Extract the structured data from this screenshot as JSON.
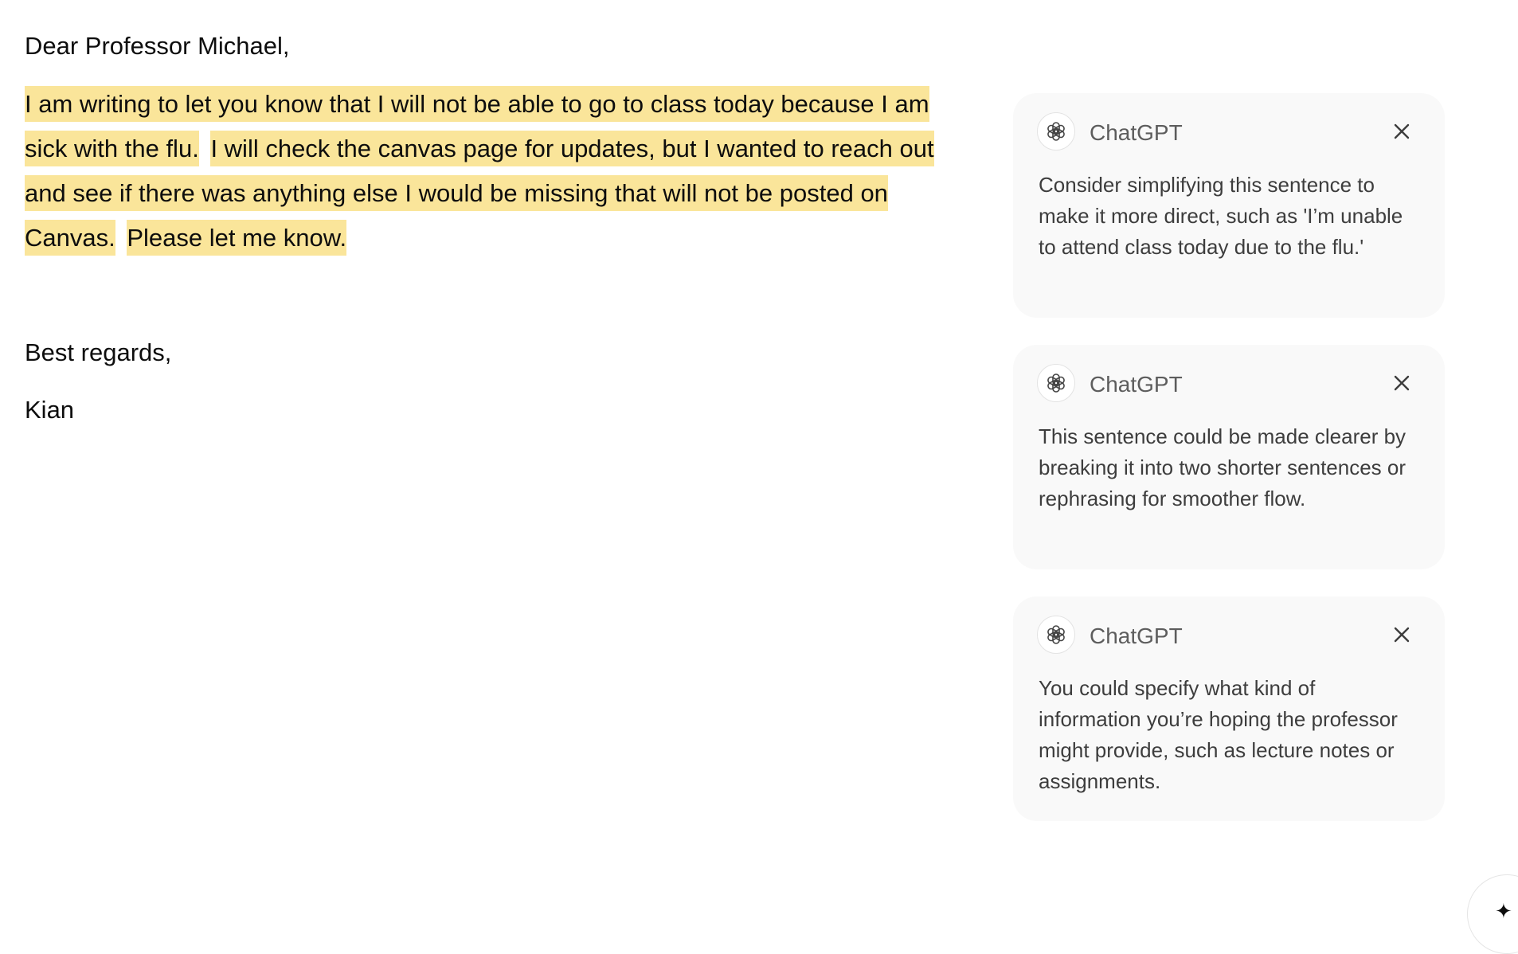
{
  "email": {
    "greeting": "Dear Professor Michael,",
    "body_sentences": [
      "I am writing to let you know that I will not be able to go to class today because I am sick with the flu.",
      "I will check the canvas page for updates, but I wanted to reach out and see if there was anything else I would be missing that will not be posted on Canvas.",
      "Please let me know."
    ],
    "closing": "Best regards,",
    "signature": "Kian"
  },
  "suggestions": [
    {
      "author": "ChatGPT",
      "icon": "openai-logo-icon",
      "text": "Consider simplifying this sentence to make it more direct, such as 'I’m unable to attend class today due to the flu.'"
    },
    {
      "author": "ChatGPT",
      "icon": "openai-logo-icon",
      "text": "This sentence could be made clearer by breaking it into two shorter sentences or rephrasing for smoother flow."
    },
    {
      "author": "ChatGPT",
      "icon": "openai-logo-icon",
      "text": "You could specify what kind of information you’re hoping the professor might provide, such as lecture notes or assignments."
    }
  ],
  "colors": {
    "highlight": "#fae59a",
    "card_background": "#f9f9f9",
    "text": "#0d0d0d",
    "muted_text": "#5d5d5d"
  }
}
